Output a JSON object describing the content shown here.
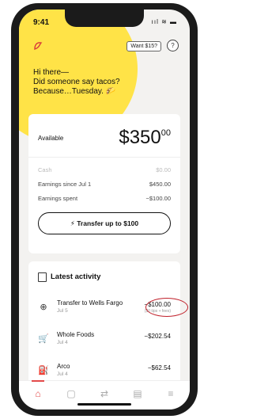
{
  "status": {
    "time": "9:41",
    "icons": "ııl ≋ ▬"
  },
  "header": {
    "want_button": "Want $15?",
    "help_icon": "?"
  },
  "greeting": {
    "line1": "Hi there—",
    "line2": "Did someone say tacos?",
    "line3": "Because…Tuesday. 🌮"
  },
  "balance_card": {
    "available_label": "Available",
    "balance_main": "$350",
    "balance_cents": "00",
    "rows": [
      {
        "label": "Cash",
        "value": "$0.00",
        "muted": true
      },
      {
        "label": "Earnings since Jul 1",
        "value": "$450.00"
      },
      {
        "label": "Earnings spent",
        "value": "−$100.00"
      }
    ],
    "transfer_button": "⚡ Transfer up to $100"
  },
  "activity": {
    "title": "Latest activity",
    "items": [
      {
        "icon": "transfer-icon",
        "glyph": "⊕",
        "name": "Transfer to Wells Fargo",
        "date": "Jul 5",
        "amount": "−$100.00",
        "note": "($0 tips + fees)"
      },
      {
        "icon": "cart-icon",
        "glyph": "🛒",
        "name": "Whole Foods",
        "date": "Jul 4",
        "amount": "−$202.54"
      },
      {
        "icon": "gas-icon",
        "glyph": "⛽",
        "name": "Arco",
        "date": "Jul 4",
        "amount": "−$62.54"
      }
    ]
  },
  "nav": {
    "items": [
      "home-icon",
      "card-icon",
      "transfer-arrows-icon",
      "document-icon",
      "menu-icon"
    ],
    "glyphs": [
      "⌂",
      "▢",
      "⇄",
      "▤",
      "≡"
    ],
    "active_color": "#e34a4a"
  },
  "colors": {
    "accent_yellow": "#ffe347",
    "highlight_red": "#c0202a"
  }
}
